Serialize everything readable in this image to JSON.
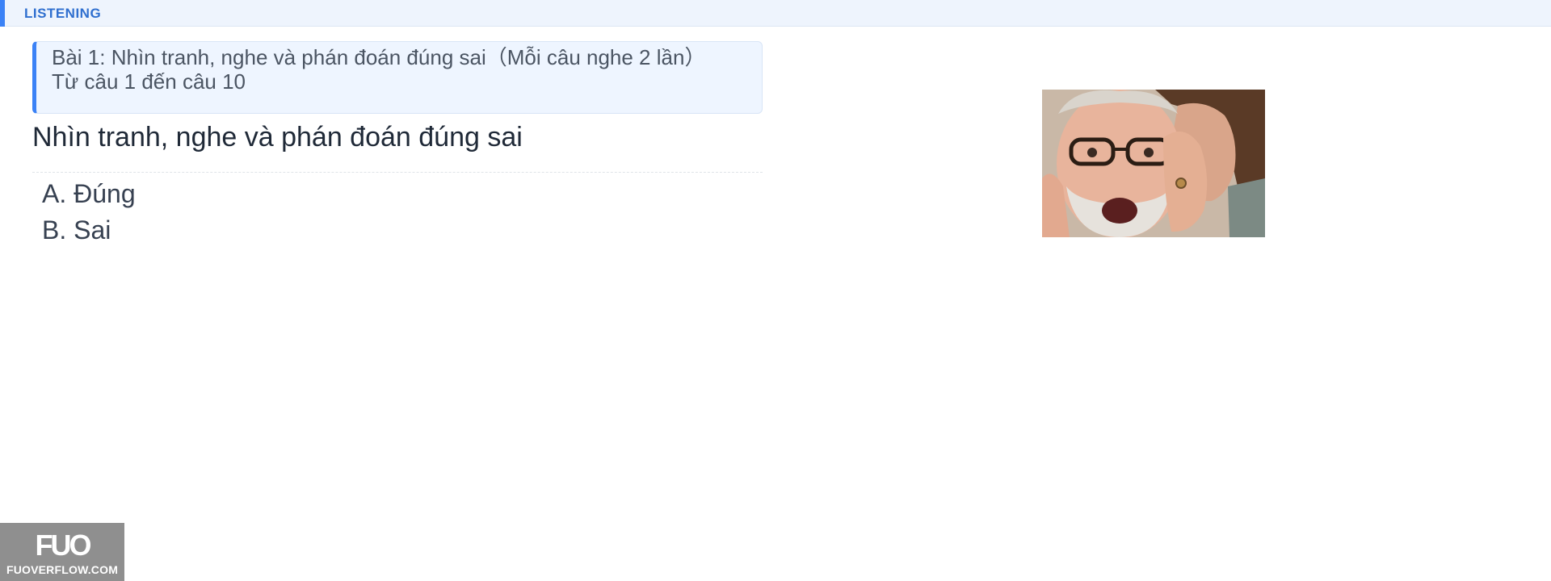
{
  "section": {
    "label": "LISTENING",
    "accent_color": "#3b82f6"
  },
  "instruction": {
    "line1": "Bài 1: Nhìn tranh, nghe và phán đoán đúng sai（Mỗi câu nghe 2 lần）",
    "line2": "Từ câu 1 đến câu 10"
  },
  "question": {
    "text": "Nhìn tranh, nghe và phán đoán đúng sai"
  },
  "options": [
    {
      "label": "A. Đúng"
    },
    {
      "label": "B. Sai"
    }
  ],
  "image": {
    "alt": "Older man with glasses looking shocked while a woman whispers in his ear"
  },
  "watermark": {
    "logo_text": "FUO",
    "site_text": "FUOVERFLOW.COM"
  }
}
